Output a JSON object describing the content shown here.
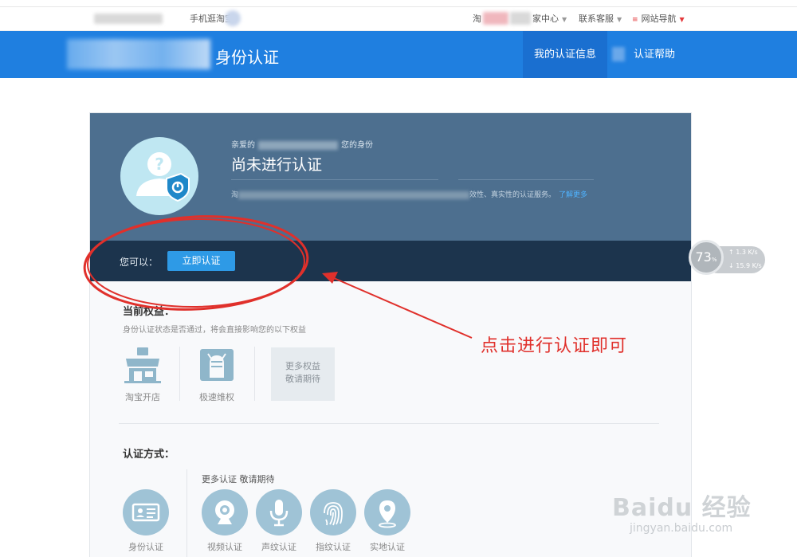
{
  "topbar": {
    "mobile": "手机逛淘宝",
    "seller_center": "家中心",
    "contact": "联系客服",
    "site_nav": "网站导航",
    "site_prefix": "淘"
  },
  "header": {
    "title": "身份认证",
    "tabs": [
      {
        "label": "我的认证信息",
        "active": true
      },
      {
        "label": "认证帮助",
        "active": false
      }
    ]
  },
  "hero": {
    "greeting_prefix": "亲爱的",
    "greeting_suffix": "您的身份",
    "status": "尚未进行认证",
    "desc_prefix": "淘",
    "desc_suffix": "效性、真实性的认证服务。",
    "learn_more": "了解更多"
  },
  "action": {
    "label": "您可以：",
    "button": "立即认证"
  },
  "perks": {
    "title": "当前权益：",
    "subtitle": "身份认证状态是否通过，将会直接影响您的以下权益",
    "items": [
      {
        "label": "淘宝开店",
        "icon": "shop-icon"
      },
      {
        "label": "极速维权",
        "icon": "fist-icon"
      }
    ],
    "more_line1": "更多权益",
    "more_line2": "敬请期待"
  },
  "methods": {
    "title": "认证方式：",
    "more_label": "更多认证 敬请期待",
    "items": [
      {
        "label": "身份认证",
        "icon": "id-card-icon"
      },
      {
        "label": "视频认证",
        "icon": "webcam-icon"
      },
      {
        "label": "声纹认证",
        "icon": "microphone-icon"
      },
      {
        "label": "指纹认证",
        "icon": "fingerprint-icon"
      },
      {
        "label": "实地认证",
        "icon": "location-pin-icon"
      }
    ]
  },
  "annotation": {
    "text": "点击进行认证即可",
    "color": "#e0302b"
  },
  "speed_widget": {
    "percent": "73",
    "percent_unit": "%",
    "upload": "1.3",
    "download": "15.9",
    "unit": "K/s"
  },
  "watermark": {
    "brand": "Baidu 经验",
    "url": "jingyan.baidu.com"
  },
  "colors": {
    "header_blue": "#1f7fe0",
    "hero_bg": "#4d6f8f",
    "action_bg": "#1c344d",
    "button_blue": "#2e9ae6"
  }
}
